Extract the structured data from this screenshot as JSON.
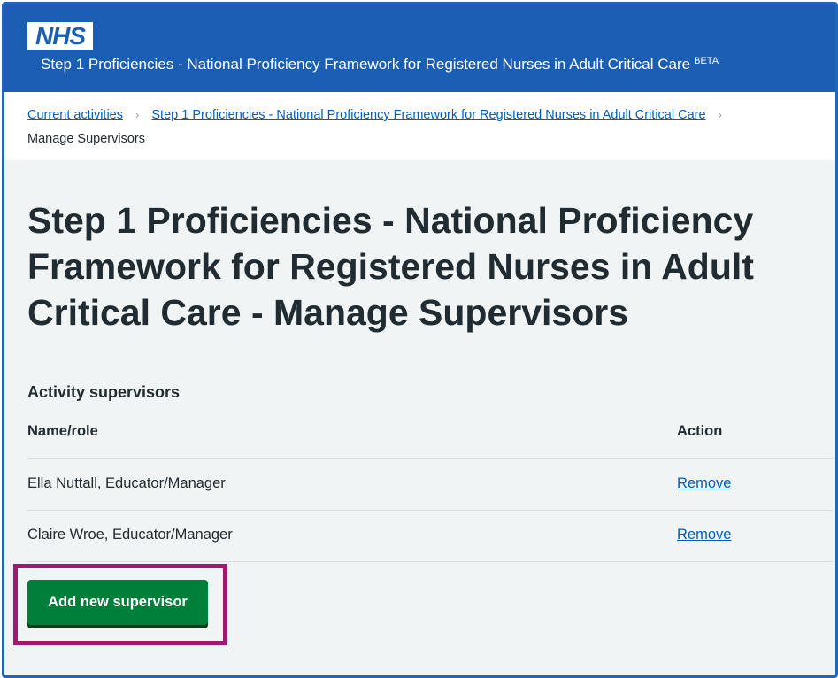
{
  "header": {
    "logo_text": "NHS",
    "service_name": "Step 1 Proficiencies - National Proficiency Framework for Registered Nurses in Adult Critical Care",
    "beta_tag": "BETA"
  },
  "breadcrumbs": {
    "items": [
      {
        "label": "Current activities"
      },
      {
        "label": "Step 1 Proficiencies - National Proficiency Framework for Registered Nurses in Adult Critical Care"
      }
    ],
    "separator": "›",
    "current": "Manage Supervisors"
  },
  "main": {
    "title": "Step 1 Proficiencies - National Proficiency Framework for Registered Nurses in Adult Critical Care - Manage Supervisors",
    "section_heading": "Activity supervisors",
    "table": {
      "columns": [
        "Name/role",
        "Action"
      ],
      "rows": [
        {
          "name": "Ella Nuttall, Educator/Manager",
          "action": "Remove"
        },
        {
          "name": "Claire Wroe, Educator/Manager",
          "action": "Remove"
        }
      ]
    },
    "add_button_label": "Add new supervisor"
  },
  "colors": {
    "header_blue": "#1a5fb4",
    "link_blue": "#005eb8",
    "button_green": "#007f3b",
    "highlight": "#a0196e",
    "background": "#f0f4f5"
  }
}
